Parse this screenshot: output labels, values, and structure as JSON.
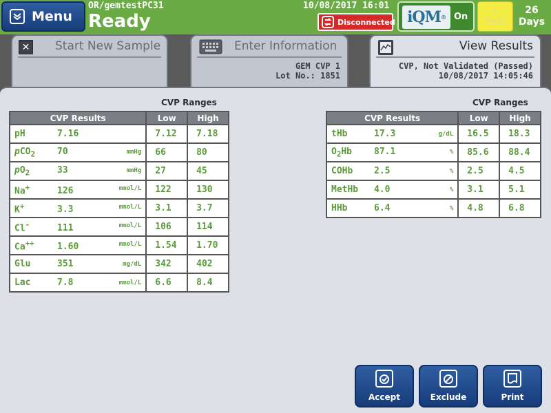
{
  "header": {
    "menu_label": "Menu",
    "system_name": "OR/gemtestPC31",
    "status": "Ready",
    "datetime": "10/08/2017 16:01",
    "connection": "Disconnected",
    "iqm_logo": "iQM",
    "iqm_state": "On",
    "tests_count": "5",
    "tests_label": "Tests",
    "days_count": "26",
    "days_label": "Days"
  },
  "tabs": [
    {
      "title": "Start New Sample"
    },
    {
      "title": "Enter Information",
      "line1": "GEM CVP 1",
      "line2": "Lot No.: 1851"
    },
    {
      "title": "View Results",
      "line1": "CVP, Not Validated (Passed)",
      "line2": "10/08/2017 14:05:46"
    }
  ],
  "left_table": {
    "ranges_title": "CVP Ranges",
    "headers": [
      "CVP Results",
      "Low",
      "High"
    ],
    "rows": [
      {
        "analyte": "pH",
        "value": "7.16",
        "unit": "",
        "low": "7.12",
        "high": "7.18"
      },
      {
        "analyte": "pCO2",
        "value": "70",
        "unit": "mmHg",
        "low": "66",
        "high": "80"
      },
      {
        "analyte": "pO2",
        "value": "33",
        "unit": "mmHg",
        "low": "27",
        "high": "45"
      },
      {
        "analyte": "Na+",
        "value": "126",
        "unit": "mmol/L",
        "low": "122",
        "high": "130"
      },
      {
        "analyte": "K+",
        "value": "3.3",
        "unit": "mmol/L",
        "low": "3.1",
        "high": "3.7"
      },
      {
        "analyte": "Cl-",
        "value": "111",
        "unit": "mmol/L",
        "low": "106",
        "high": "114"
      },
      {
        "analyte": "Ca++",
        "value": "1.60",
        "unit": "mmol/L",
        "low": "1.54",
        "high": "1.70"
      },
      {
        "analyte": "Glu",
        "value": "351",
        "unit": "mg/dL",
        "low": "342",
        "high": "402"
      },
      {
        "analyte": "Lac",
        "value": "7.8",
        "unit": "mmol/L",
        "low": "6.6",
        "high": "8.4"
      }
    ]
  },
  "right_table": {
    "ranges_title": "CVP Ranges",
    "headers": [
      "CVP Results",
      "Low",
      "High"
    ],
    "rows": [
      {
        "analyte": "tHb",
        "value": "17.3",
        "unit": "g/dL",
        "low": "16.5",
        "high": "18.3"
      },
      {
        "analyte": "O2Hb",
        "value": "87.1",
        "unit": "%",
        "low": "85.6",
        "high": "88.4"
      },
      {
        "analyte": "COHb",
        "value": "2.5",
        "unit": "%",
        "low": "2.5",
        "high": "4.5"
      },
      {
        "analyte": "MetHb",
        "value": "4.0",
        "unit": "%",
        "low": "3.1",
        "high": "5.1"
      },
      {
        "analyte": "HHb",
        "value": "6.4",
        "unit": "%",
        "low": "4.8",
        "high": "6.8"
      }
    ]
  },
  "buttons": {
    "accept": "Accept",
    "exclude": "Exclude",
    "print": "Print"
  },
  "colors": {
    "header_green": "#6aab46",
    "value_green": "#5c9a3c",
    "button_blue": "#1f4a8c",
    "disconnected_red": "#d42a2a",
    "tests_yellow": "#f2ec43"
  },
  "icons": {
    "menu": "chevron-down-icon",
    "disconnected": "disconnect-icon",
    "close": "close-icon",
    "keyboard": "keyboard-icon",
    "results": "chart-icon",
    "accept": "accept-icon",
    "exclude": "exclude-icon",
    "print": "print-icon"
  }
}
